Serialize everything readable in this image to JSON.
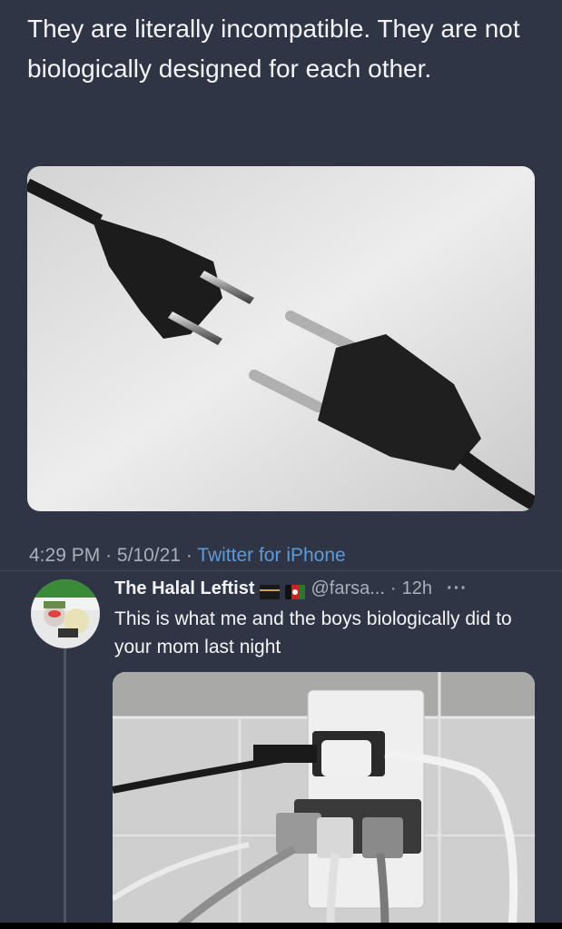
{
  "tweet": {
    "text": "They are literally incompatible. They are not biologically designed for each other.",
    "time": "4:29 PM",
    "date": "5/10/21",
    "source": "Twitter for iPhone",
    "separator": "·"
  },
  "reply": {
    "name": "The Halal Leftist",
    "handle": "@farsa...",
    "time_prefix": "·",
    "time": "12h",
    "more": "···",
    "text": "This is what me and the boys biologically did to your mom last night"
  },
  "icons": [
    "kaaba-flag-icon",
    "afghanistan-flag-icon",
    "more-icon"
  ],
  "colors": {
    "background": "#2f3544",
    "link": "#5d9ad8",
    "secondary_text": "#a9b0bc"
  }
}
